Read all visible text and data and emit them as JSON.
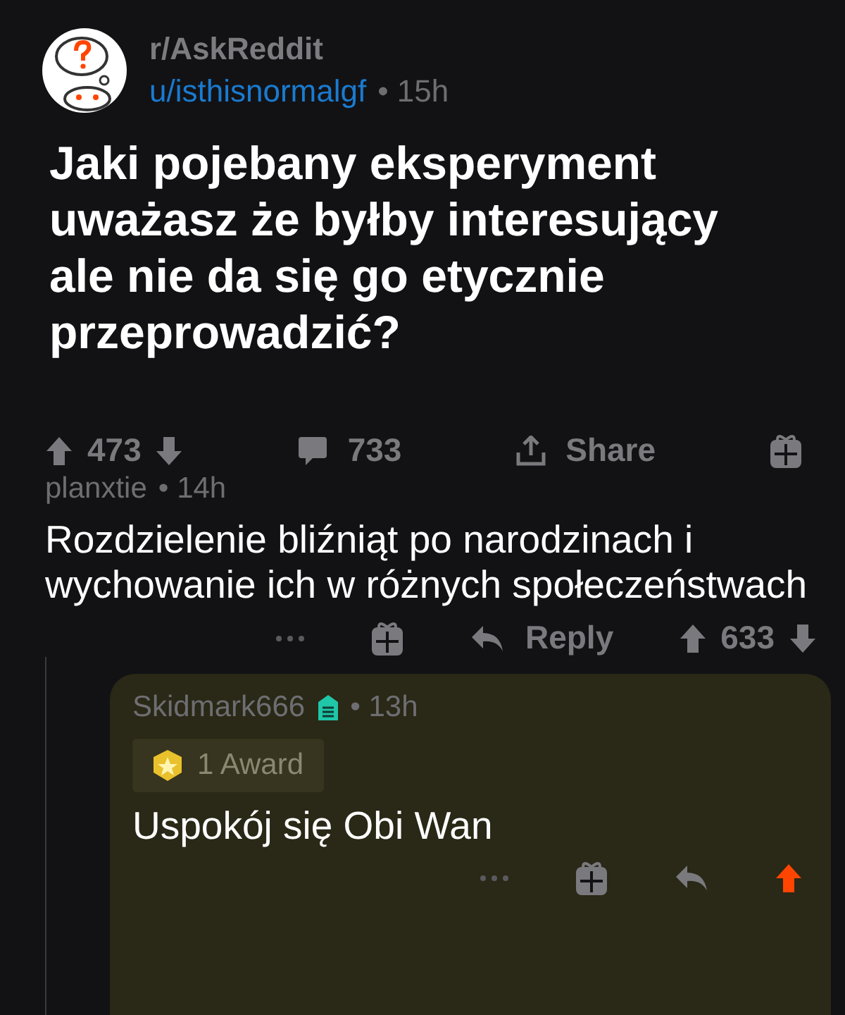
{
  "post": {
    "subreddit": "r/AskReddit",
    "author": "u/isthisnormalgf",
    "age": "• 15h",
    "title": "Jaki pojebany eksperyment uważasz że byłby interesujący ale nie da się go etycznie przeprowadzić?",
    "votes": "473",
    "upvoted": false,
    "comments": "733",
    "share": "Share"
  },
  "comments": [
    {
      "author": "planxtie",
      "badge": false,
      "age": "• 14h",
      "body": "Rozdzielenie bliźniąt po narodzinach i wychowanie ich w różnych społeczeństwach",
      "reply": "Reply",
      "votes": "633",
      "upvoted": false,
      "highlighted": false
    },
    {
      "author": "Skidmark666",
      "badge": true,
      "age": "• 13h",
      "award": "1 Award",
      "body": "Uspokój się Obi Wan",
      "upvoted": true,
      "highlighted": true
    }
  ]
}
